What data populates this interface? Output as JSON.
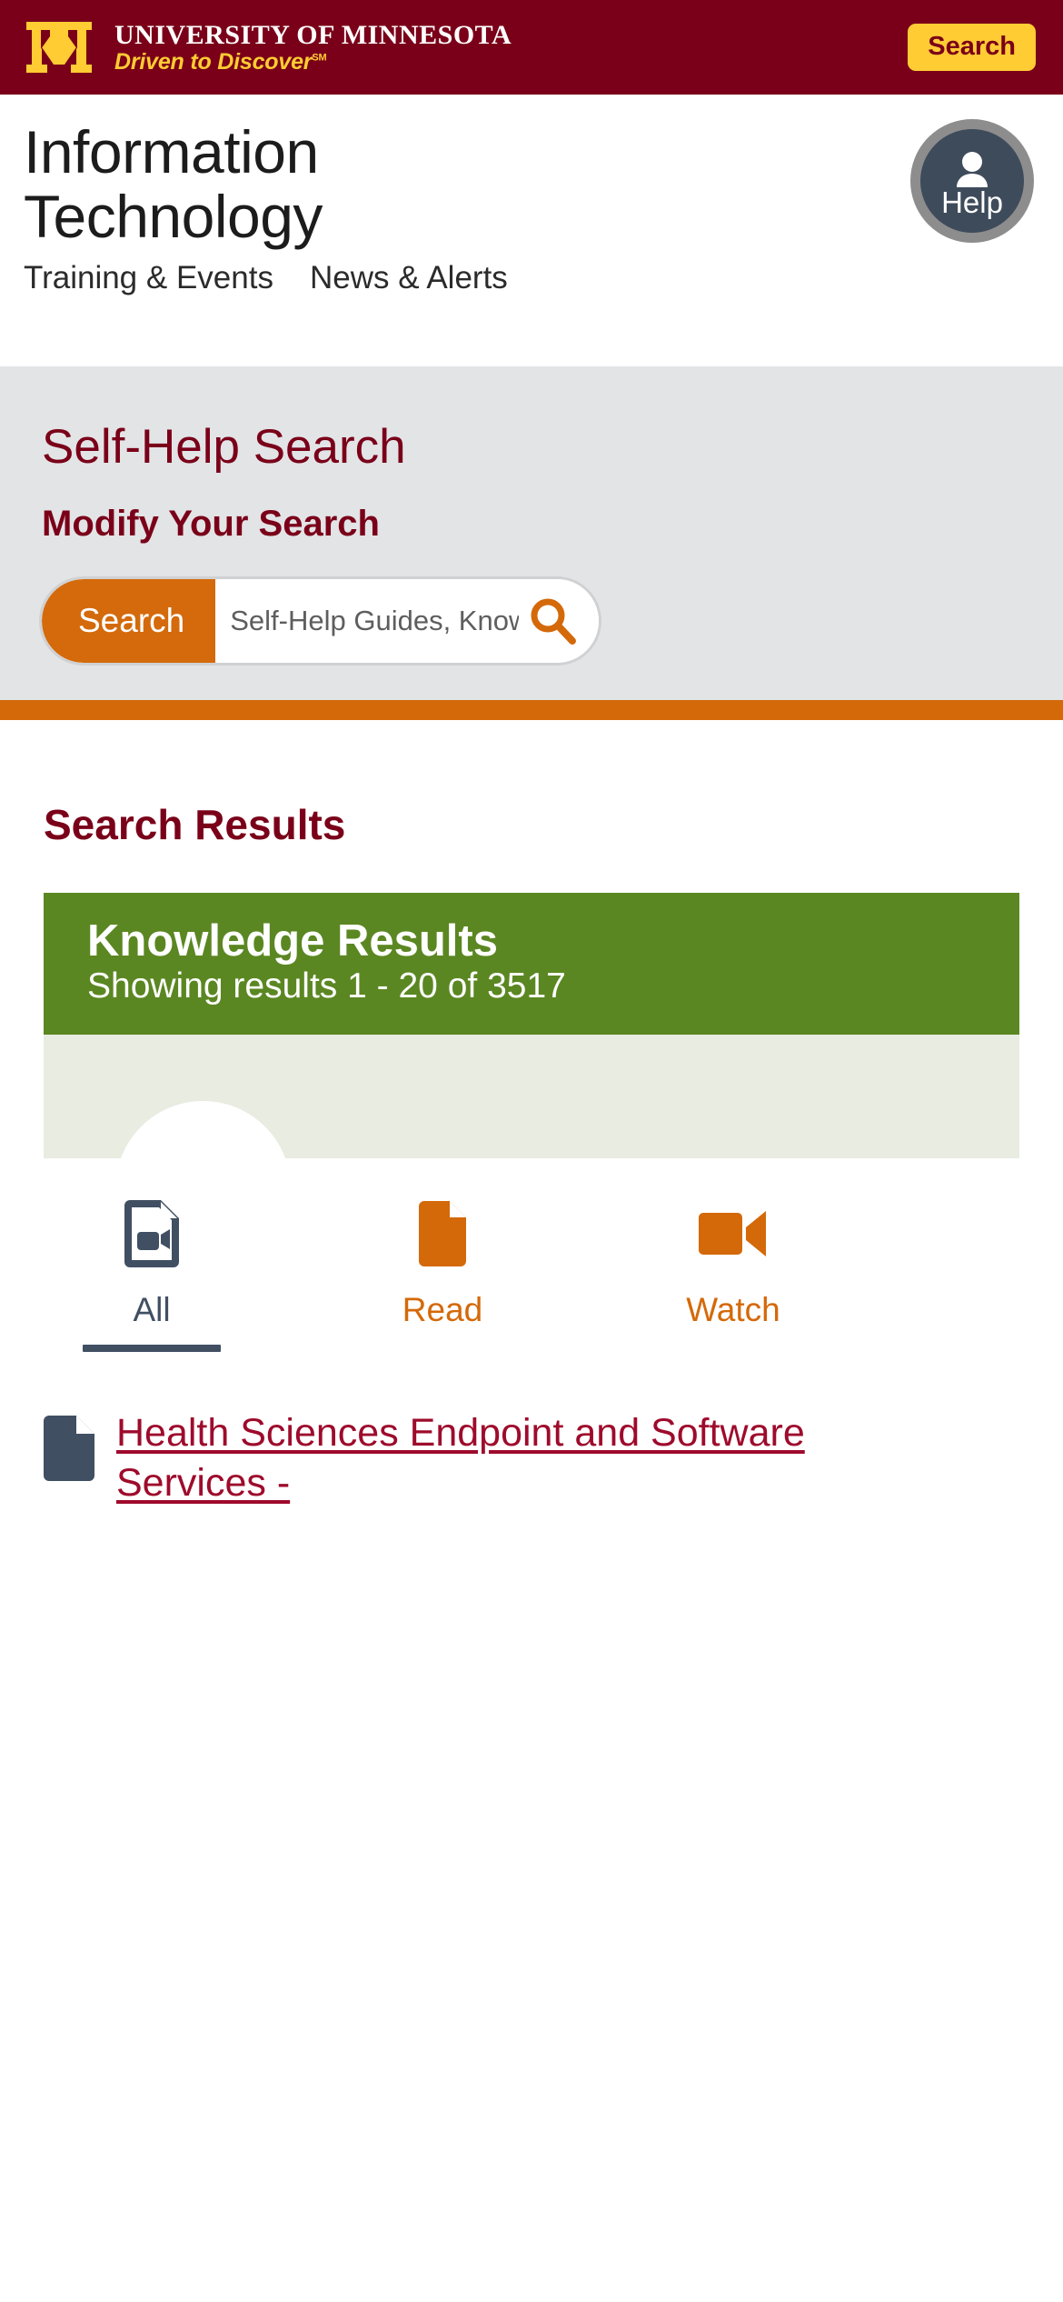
{
  "banner": {
    "logo_alt": "university-of-minnesota-m-logo",
    "university_name": "UNIVERSITY OF MINNESOTA",
    "tagline": "Driven to Discover",
    "tagline_sup": "SM",
    "search_button": "Search"
  },
  "header": {
    "site_title": "Information Technology",
    "help_label": "Help",
    "nav": [
      {
        "label": "Training & Events"
      },
      {
        "label": "News & Alerts"
      }
    ]
  },
  "search_panel": {
    "title": "Self-Help Search",
    "subtitle": "Modify Your Search",
    "submit_label": "Search",
    "input_value": "",
    "input_placeholder": "Self-Help Guides, Knowledge Articles"
  },
  "results": {
    "heading": "Search Results",
    "knowledge_card": {
      "title": "Knowledge Results",
      "showing": "Showing results 1 - 20 of 3517",
      "range_start": 1,
      "range_end": 20,
      "total": 3517
    },
    "tabs": [
      {
        "label": "All",
        "icon": "document-video-icon",
        "active": true
      },
      {
        "label": "Read",
        "icon": "document-icon",
        "active": false
      },
      {
        "label": "Watch",
        "icon": "video-camera-icon",
        "active": false
      }
    ],
    "items": [
      {
        "icon": "document-icon",
        "title": "Health Sciences Endpoint and Software Services -"
      }
    ]
  },
  "colors": {
    "maroon": "#7a0019",
    "gold": "#ffcc33",
    "orange": "#d4690a",
    "green": "#5b8722",
    "green_light": "#e8ece1",
    "slate": "#414f63",
    "panel_gray": "#e2e4e6",
    "link_maroon": "#9e0b2c"
  }
}
